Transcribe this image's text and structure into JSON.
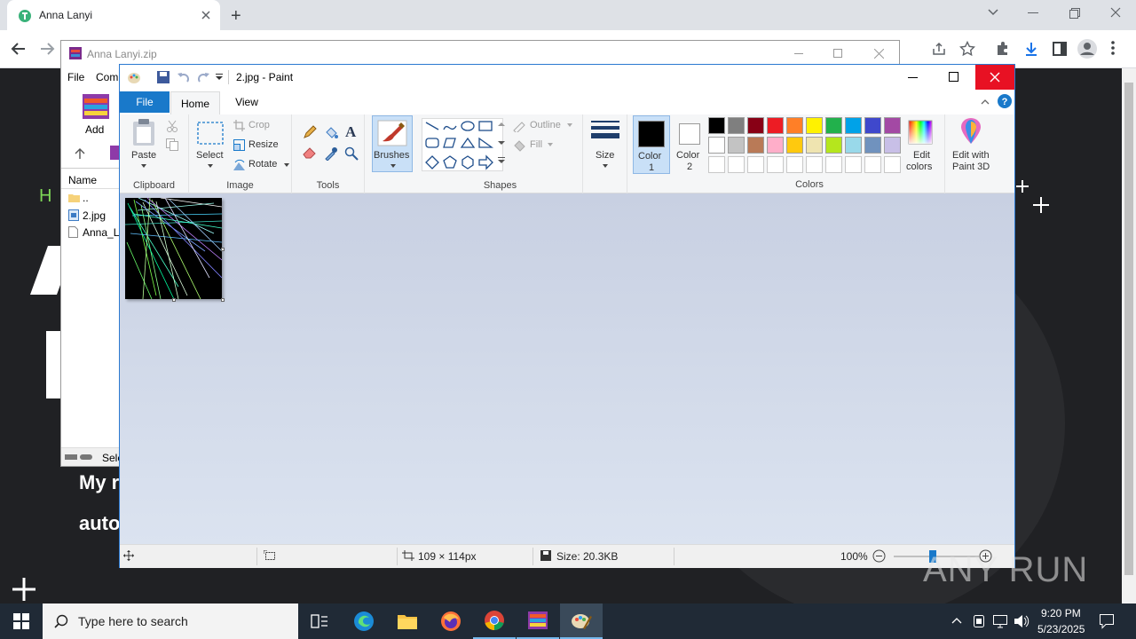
{
  "browser": {
    "tab_title": "Anna Lanyi",
    "new_tab_symbol": "+"
  },
  "page_bg": {
    "greeting": "H I",
    "line1": "My r",
    "line2": "auto"
  },
  "winrar": {
    "title": "Anna Lanyi.zip",
    "menu": [
      "File",
      "Com"
    ],
    "add_label": "Add",
    "column_name": "Name",
    "files": [
      "..",
      "2.jpg",
      "Anna_L"
    ],
    "status": "Sele"
  },
  "paint": {
    "title": "2.jpg - Paint",
    "tabs": {
      "file": "File",
      "home": "Home",
      "view": "View"
    },
    "clipboard": {
      "paste": "Paste",
      "label": "Clipboard"
    },
    "image": {
      "select": "Select",
      "crop": "Crop",
      "resize": "Resize",
      "rotate": "Rotate",
      "label": "Image"
    },
    "tools": {
      "label": "Tools"
    },
    "brushes": "Brushes",
    "shapes": {
      "outline": "Outline",
      "fill": "Fill",
      "label": "Shapes"
    },
    "size": "Size",
    "color1": {
      "l1": "Color",
      "l2": "1"
    },
    "color2": {
      "l1": "Color",
      "l2": "2"
    },
    "colors_label": "Colors",
    "edit_colors": {
      "l1": "Edit",
      "l2": "colors"
    },
    "paint3d": {
      "l1": "Edit with",
      "l2": "Paint 3D"
    },
    "palette_row1": [
      "#000000",
      "#7f7f7f",
      "#880015",
      "#ed1c24",
      "#ff7f27",
      "#fff200",
      "#22b14c",
      "#00a2e8",
      "#3f48cc",
      "#a349a4"
    ],
    "palette_row2": [
      "#ffffff",
      "#c3c3c3",
      "#b97a57",
      "#ffaec9",
      "#ffc90e",
      "#efe4b0",
      "#b5e61d",
      "#99d9ea",
      "#7092be",
      "#c8bfe7"
    ],
    "status": {
      "dimensions": "109 × 114px",
      "size": "Size: 20.3KB",
      "zoom": "100%"
    }
  },
  "taskbar": {
    "search_placeholder": "Type here to search",
    "time": "9:20 PM",
    "date": "5/23/2025"
  },
  "watermark": "ANY RUN"
}
